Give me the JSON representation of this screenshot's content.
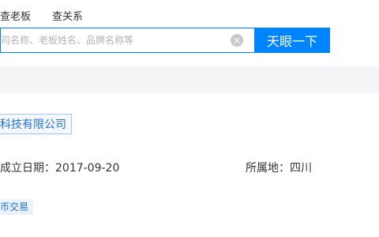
{
  "search": {
    "tabs": [
      {
        "label": "查老板"
      },
      {
        "label": "查关系"
      }
    ],
    "placeholder": "司名称、老板姓名、品牌名称等",
    "clear_icon": "×",
    "button_label": "天眼一下"
  },
  "result": {
    "company_name": "科技有限公司",
    "established_text": "成立日期：2017-09-20",
    "region_text": "所属地：四川",
    "tag_text": "币交易"
  },
  "colors": {
    "accent": "#0084ff",
    "link": "#1d6fd8",
    "band_bg": "#f4f5f7"
  }
}
